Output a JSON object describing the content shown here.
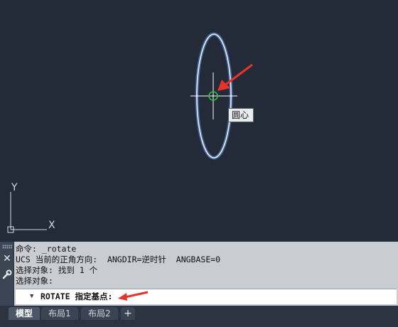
{
  "canvas": {
    "ucs_y_label": "Y",
    "ucs_x_label": "X",
    "tooltip": "圆心",
    "colors": {
      "background": "#222b37",
      "ellipse": "#cfe2ff",
      "crosshair": "#ffffff",
      "snap_marker": "#2fbf3a",
      "arrow": "#e8322c"
    }
  },
  "command_panel": {
    "history": [
      "命令: _rotate",
      "UCS 当前的正角方向:  ANGDIR=逆时针  ANGBASE=0",
      "选择对象: 找到 1 个",
      "选择对象:"
    ],
    "prompt": "ROTATE 指定基点:",
    "icons": [
      "close-icon",
      "wrench-icon"
    ]
  },
  "tabs": {
    "items": [
      {
        "label": "模型",
        "active": true
      },
      {
        "label": "布局1",
        "active": false
      },
      {
        "label": "布局2",
        "active": false
      }
    ],
    "add_label": "+"
  }
}
